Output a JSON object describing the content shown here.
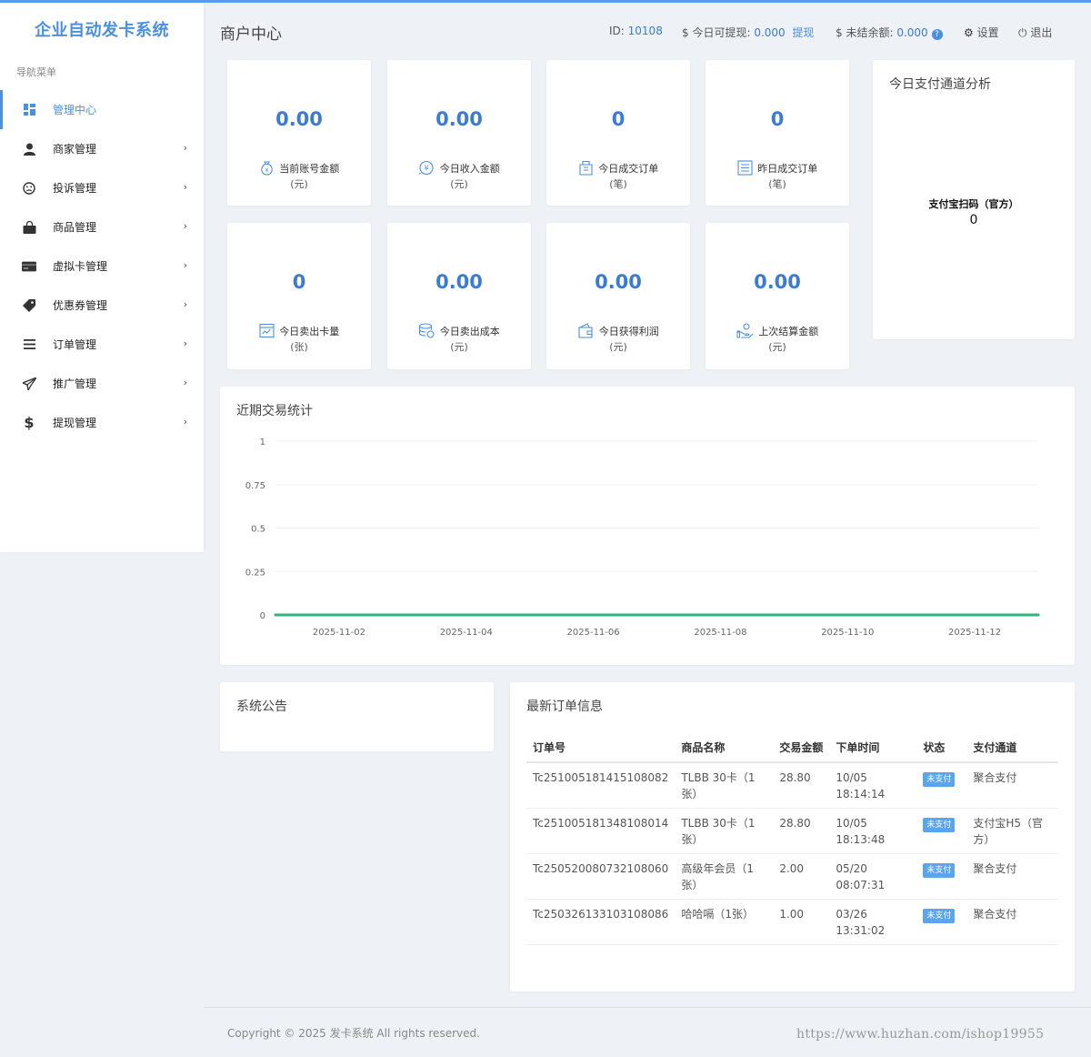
{
  "app": {
    "brand": "企业自动发卡系统",
    "accent": "#4a8fe0"
  },
  "sidebar": {
    "heading": "导航菜单",
    "items": [
      {
        "label": "管理中心",
        "icon": "dashboard-icon",
        "active": true,
        "has_arrow": false
      },
      {
        "label": "商家管理",
        "icon": "user-icon",
        "has_arrow": true
      },
      {
        "label": "投诉管理",
        "icon": "frown-icon",
        "has_arrow": true
      },
      {
        "label": "商品管理",
        "icon": "shopping-bag-icon",
        "has_arrow": true
      },
      {
        "label": "虚拟卡管理",
        "icon": "credit-card-icon",
        "has_arrow": true
      },
      {
        "label": "优惠券管理",
        "icon": "tag-icon",
        "has_arrow": true
      },
      {
        "label": "订单管理",
        "icon": "list-icon",
        "has_arrow": true
      },
      {
        "label": "推广管理",
        "icon": "send-icon",
        "has_arrow": true
      },
      {
        "label": "提现管理",
        "icon": "dollar-icon",
        "has_arrow": true
      }
    ]
  },
  "header": {
    "title": "商户中心",
    "id_label": "ID:",
    "id_value": "10108",
    "withdrawable_label": "$ 今日可提现:",
    "withdrawable_value": "0.000",
    "withdraw_link": "提现",
    "unsettled_label": "$ 未结余额:",
    "unsettled_value": "0.000",
    "unsettled_help": "?",
    "settings_label": "设置",
    "logout_label": "退出"
  },
  "stats": [
    {
      "value": "0.00",
      "label": "当前账号金额",
      "unit": "(元)",
      "icon": "money-bag-icon"
    },
    {
      "value": "0.00",
      "label": "今日收入金额",
      "unit": "(元)",
      "icon": "yen-coin-icon"
    },
    {
      "value": "0",
      "label": "今日成交订单",
      "unit": "(笔)",
      "icon": "order-bag-icon"
    },
    {
      "value": "0",
      "label": "昨日成交订单",
      "unit": "(笔)",
      "icon": "list-doc-icon"
    },
    {
      "value": "0",
      "label": "今日卖出卡量",
      "unit": "(张)",
      "icon": "card-window-icon"
    },
    {
      "value": "0.00",
      "label": "今日卖出成本",
      "unit": "(元)",
      "icon": "coin-stack-icon"
    },
    {
      "value": "0.00",
      "label": "今日获得利润",
      "unit": "(元)",
      "icon": "wallet-icon"
    },
    {
      "value": "0.00",
      "label": "上次结算金额",
      "unit": "(元)",
      "icon": "hand-coin-icon"
    }
  ],
  "pay_channel": {
    "title": "今日支付通道分析",
    "items": [
      {
        "name": "支付宝扫码（官方）",
        "value": "0"
      }
    ]
  },
  "recent": {
    "title": "近期交易统计"
  },
  "chart_data": {
    "type": "line",
    "title": "近期交易统计",
    "x": [
      "2025-11-01",
      "2025-11-02",
      "2025-11-03",
      "2025-11-04",
      "2025-11-05",
      "2025-11-06",
      "2025-11-07",
      "2025-11-08",
      "2025-11-09",
      "2025-11-10",
      "2025-11-11",
      "2025-11-12",
      "2025-11-13"
    ],
    "x_tick_labels": [
      "2025-11-02",
      "2025-11-04",
      "2025-11-06",
      "2025-11-08",
      "2025-11-10",
      "2025-11-12"
    ],
    "series": [
      {
        "values": [
          0,
          0,
          0,
          0,
          0,
          0,
          0,
          0,
          0,
          0,
          0,
          0,
          0
        ],
        "color": "#2db67c"
      }
    ],
    "ylim": [
      0,
      1
    ],
    "y_ticks": [
      0,
      0.25,
      0.5,
      0.75,
      1
    ],
    "grid": true
  },
  "notice": {
    "title": "系统公告"
  },
  "orders": {
    "title": "最新订单信息",
    "columns": [
      "订单号",
      "商品名称",
      "交易金额",
      "下单时间",
      "状态",
      "支付通道"
    ],
    "rows": [
      {
        "order_no": "Tc251005181415108082",
        "product": "TLBB 30卡（1张）",
        "amount": "28.80",
        "time": "10/05 18:14:14",
        "status": "未支付",
        "channel": "聚合支付"
      },
      {
        "order_no": "Tc251005181348108014",
        "product": "TLBB 30卡（1张）",
        "amount": "28.80",
        "time": "10/05 18:13:48",
        "status": "未支付",
        "channel": "支付宝H5（官方）"
      },
      {
        "order_no": "Tc250520080732108060",
        "product": "高级年会员（1张）",
        "amount": "2.00",
        "time": "05/20 08:07:31",
        "status": "未支付",
        "channel": "聚合支付"
      },
      {
        "order_no": "Tc250326133103108086",
        "product": "哈哈嗝（1张）",
        "amount": "1.00",
        "time": "03/26 13:31:02",
        "status": "未支付",
        "channel": "聚合支付"
      }
    ]
  },
  "footer": {
    "copyright": "Copyright © 2025 发卡系统 All rights reserved.",
    "watermark": "https://www.huzhan.com/ishop19955"
  }
}
